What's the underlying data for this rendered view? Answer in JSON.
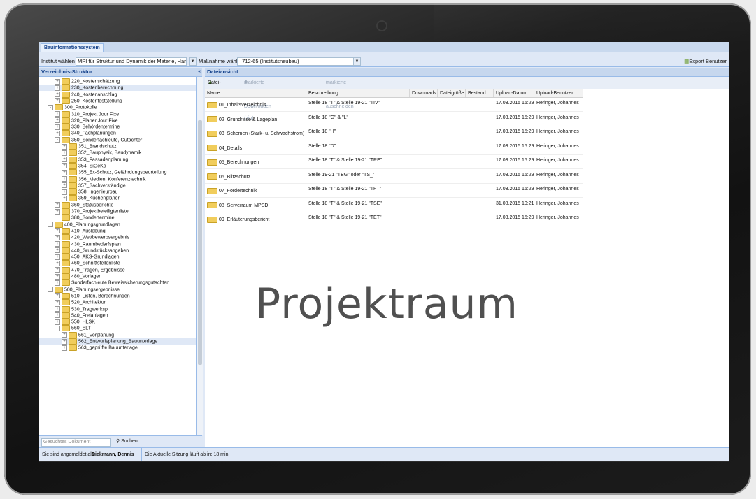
{
  "app_tab": "Bauinformationssystem",
  "toolbar": {
    "institut_label": "Institut wählen",
    "institut_value": "MPI für Struktur und Dynamik der Materie, Hamburg)",
    "massnahme_label": "Maßnahme wählen",
    "massnahme_value": "_712-65 (Institutsneubau)",
    "export_label": "Export Benutzer"
  },
  "tree_panel": {
    "title": "Verzeichnis-Struktur",
    "nodes": [
      {
        "label": "220_Kostenschätzung",
        "depth": 2,
        "expander": "+"
      },
      {
        "label": "230_Kostenberechnung",
        "depth": 2,
        "expander": "+",
        "selected": true
      },
      {
        "label": "240_Kostenanschlag",
        "depth": 2,
        "expander": "+"
      },
      {
        "label": "250_Kostenfeststellung",
        "depth": 2,
        "expander": "+"
      },
      {
        "label": "300_Protokolle",
        "depth": 1,
        "expander": "-"
      },
      {
        "label": "310_Projekt Jour Fixe",
        "depth": 2,
        "expander": "+"
      },
      {
        "label": "320_Planer Jour Fixe",
        "depth": 2,
        "expander": "+"
      },
      {
        "label": "330_Behördentermine",
        "depth": 2,
        "expander": "+"
      },
      {
        "label": "340_Fachplanungen",
        "depth": 2,
        "expander": "+"
      },
      {
        "label": "350_Sonderfachleute, Gutachter",
        "depth": 2,
        "expander": "-"
      },
      {
        "label": "351_Brandschutz",
        "depth": 3,
        "expander": "+"
      },
      {
        "label": "352_Bauphysik, Baudynamik",
        "depth": 3,
        "expander": "+"
      },
      {
        "label": "353_Fassadenplanung",
        "depth": 3,
        "expander": "+"
      },
      {
        "label": "354_SiGeKo",
        "depth": 3,
        "expander": "+"
      },
      {
        "label": "355_Ex-Schutz, Gefährdungsbeurteilung",
        "depth": 3,
        "expander": "+"
      },
      {
        "label": "356_Medien, Konferenztechnik",
        "depth": 3,
        "expander": "+"
      },
      {
        "label": "357_Sachverständige",
        "depth": 3,
        "expander": "+"
      },
      {
        "label": "358_Ingenieurbau",
        "depth": 3,
        "expander": "+"
      },
      {
        "label": "359_Küchenplaner",
        "depth": 3,
        "expander": "+"
      },
      {
        "label": "360_Statusberichte",
        "depth": 2,
        "expander": "+"
      },
      {
        "label": "370_Projektbeteiligtenliste",
        "depth": 2,
        "expander": "+"
      },
      {
        "label": "380_Sondertermine",
        "depth": 2,
        "expander": ""
      },
      {
        "label": "400_Planungsgrundlagen",
        "depth": 1,
        "expander": "-"
      },
      {
        "label": "410_Auslobung",
        "depth": 2,
        "expander": "+"
      },
      {
        "label": "420_Wettbewerbsergebnis",
        "depth": 2,
        "expander": "+"
      },
      {
        "label": "430_Raumbedarfsplan",
        "depth": 2,
        "expander": "+"
      },
      {
        "label": "440_Grundstücksangaben",
        "depth": 2,
        "expander": "+"
      },
      {
        "label": "450_AKS-Grundlagen",
        "depth": 2,
        "expander": "+"
      },
      {
        "label": "460_Schnittstellenliste",
        "depth": 2,
        "expander": "+"
      },
      {
        "label": "470_Fragen, Ergebnisse",
        "depth": 2,
        "expander": "+"
      },
      {
        "label": "480_Vorlagen",
        "depth": 2,
        "expander": "+"
      },
      {
        "label": "Sonderfachleute Beweissicherungsgutachten",
        "depth": 2,
        "expander": "+"
      },
      {
        "label": "500_Planungsergebnisse",
        "depth": 1,
        "expander": "-"
      },
      {
        "label": "510_Listen, Berechnungen",
        "depth": 2,
        "expander": "+"
      },
      {
        "label": "520_Architektur",
        "depth": 2,
        "expander": "+"
      },
      {
        "label": "530_Tragwerkspl",
        "depth": 2,
        "expander": "+"
      },
      {
        "label": "540_Freianlagen",
        "depth": 2,
        "expander": "+"
      },
      {
        "label": "550_HLSK",
        "depth": 2,
        "expander": "+"
      },
      {
        "label": "560_ELT",
        "depth": 2,
        "expander": "-"
      },
      {
        "label": "561_Vorplanung",
        "depth": 3,
        "expander": "+"
      },
      {
        "label": "562_Entwurfsplanung_Bauunterlage",
        "depth": 3,
        "expander": "+",
        "selected": true
      },
      {
        "label": "563_geprüfte Bauunterlage",
        "depth": 3,
        "expander": "+"
      }
    ],
    "search_placeholder": "Gesuchtes Dokument",
    "search_button": "Suchen"
  },
  "file_panel": {
    "title": "Dateiansicht",
    "actions": {
      "upload": "Datei-Upload",
      "download": "markierte Dateien-Downloaden (zip)",
      "check_out": "markierte Datei auschneiden"
    },
    "columns": [
      "Name",
      "Beschreibung",
      "Downloads",
      "Dateigröße",
      "Bestand",
      "Upload-Datum",
      "Upload-Benutzer"
    ],
    "rows": [
      {
        "name": "01_Inhaltsverzeichnis",
        "desc": "Stelle 18 \"T\" & Stelle 19-21 \"TIV\"",
        "date": "17.03.2015 15:29",
        "user": "Heringer, Johannes"
      },
      {
        "name": "02_Grundrisse & Lageplan",
        "desc": "Stelle 18 \"G\" & \"L\"",
        "date": "17.03.2015 15:29",
        "user": "Heringer, Johannes"
      },
      {
        "name": "03_Schemen (Stark- u. Schwachstrom)",
        "desc": "Stelle 18 \"H\"",
        "date": "17.03.2015 15:29",
        "user": "Heringer, Johannes"
      },
      {
        "name": "04_Details",
        "desc": "Stelle 18 \"D\"",
        "date": "17.03.2015 15:29",
        "user": "Heringer, Johannes"
      },
      {
        "name": "05_Berechnungen",
        "desc": "Stelle 18 \"T\" & Stelle 19-21 \"TRE\"",
        "date": "17.03.2015 15:29",
        "user": "Heringer, Johannes"
      },
      {
        "name": "06_Blitzschutz",
        "desc": "Stelle 19-21 \"TBG\" oder \"TS_\"",
        "date": "17.03.2015 15:29",
        "user": "Heringer, Johannes"
      },
      {
        "name": "07_Fördertechnik",
        "desc": "Stelle 18 \"T\" & Stelle 19-21 \"TFT\"",
        "date": "17.03.2015 15:29",
        "user": "Heringer, Johannes"
      },
      {
        "name": "08_Serverraum MPSD",
        "desc": "Stelle 18 \"T\" & Stelle 19-21 \"TSE\"",
        "date": "31.08.2015 10:21",
        "user": "Heringer, Johannes"
      },
      {
        "name": "09_Erläuterungsbericht",
        "desc": "Stelle 18 \"T\" & Stelle 19-21 \"TET\"",
        "date": "17.03.2015 15:29",
        "user": "Heringer, Johannes"
      }
    ]
  },
  "overlay_text": "Projektraum",
  "status": {
    "logged_in_label": "Sie sind angemeldet als:",
    "logged_in_user": "Diekmann, Dennis",
    "session": "Die Aktuelle Sitzung läuft ab in: 18 min"
  },
  "colors": {
    "panel_header": "#c6d7ee",
    "border": "#99bbe8",
    "folder": "#f1cd5c",
    "bezel": "#1a1a1a"
  }
}
